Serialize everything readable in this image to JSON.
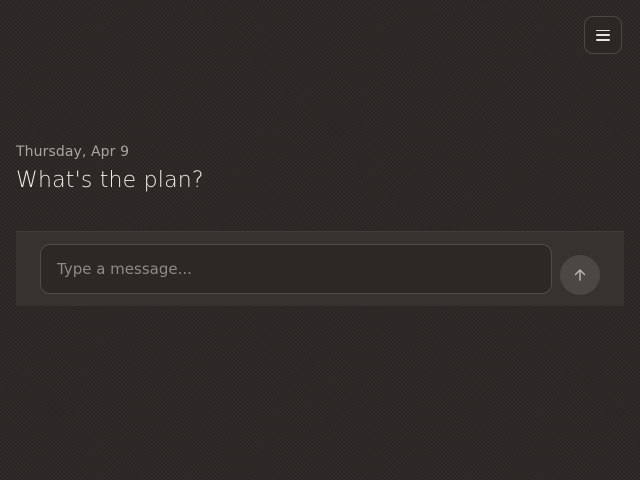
{
  "header": {
    "menu_icon": "hamburger-menu-icon"
  },
  "main": {
    "date": "Thursday, Apr 9",
    "headline": "What's the plan?"
  },
  "composer": {
    "placeholder": "Type a message...",
    "value": "",
    "send_icon": "arrow-up-icon"
  },
  "colors": {
    "background": "#2b2826",
    "composer_background": "#35322f",
    "input_border": "#4f4b48",
    "send_button": "#4a4744",
    "text_primary": "#f0ece8",
    "text_secondary": "#a9a4a0"
  }
}
